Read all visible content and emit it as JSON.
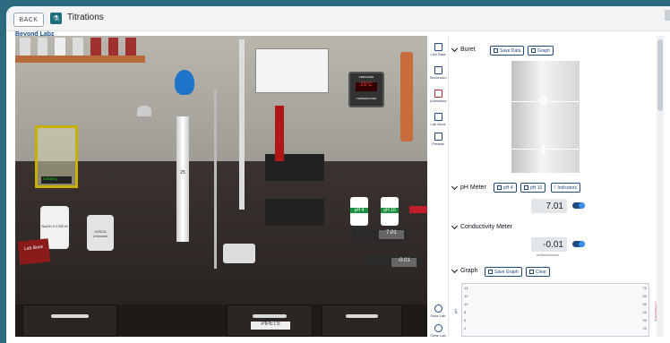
{
  "app": {
    "back_label": "BACK",
    "title": "Titrations",
    "brand": "Beyond Labz"
  },
  "side_nav": [
    {
      "label": "Live Data",
      "icon": "table-icon"
    },
    {
      "label": "Stockroom",
      "icon": "stockroom-icon"
    },
    {
      "label": "Unknowns",
      "icon": "flask-icon"
    },
    {
      "label": "Lab Book",
      "icon": "book-icon"
    },
    {
      "label": "Presets",
      "icon": "presets-icon"
    }
  ],
  "side_bottom": [
    {
      "label": "Save Lab",
      "icon": "upload-icon"
    },
    {
      "label": "Clear Lab",
      "icon": "refresh-icon"
    }
  ],
  "buret": {
    "header": "Buret",
    "save_data": "Save Data",
    "graph": "Graph",
    "marks": [
      "0",
      "1"
    ]
  },
  "ph_meter": {
    "header": "pH Meter",
    "ph4": "pH 4",
    "ph10": "pH 10",
    "indicators": "Indicators",
    "value": "7.01"
  },
  "conductivity": {
    "header": "Conductivity Meter",
    "value": "-0.01",
    "unit": "mSiemens/cm"
  },
  "graph": {
    "header": "Graph",
    "save_graph": "Save Graph",
    "clear": "Clear",
    "left_ticks": [
      "14",
      "12",
      "10",
      "8",
      "6",
      "4"
    ],
    "right_ticks": [
      "70",
      "60",
      "50",
      "40",
      "30",
      "20"
    ],
    "left_axis": "pH",
    "right_axis": "Conductivity"
  },
  "lab_scene": {
    "pressure_title": "PRESSURE",
    "temperature_readout": "25°C",
    "temperature_label": "TEMPERATURE",
    "balance_readout": "0.0000 g",
    "buret_mark": "25",
    "bottle_naoh": "NaOH 0.2785 M",
    "bottle_h2so4": "H2SO4 Unknown",
    "lab_book": "Lab Book",
    "ph4_bottle": "pH 4",
    "ph10_bottle": "pH 10",
    "ph_meter_reading": "7.01",
    "cond_meter_reading": "-0.01",
    "drawer_label": "PIPETS"
  },
  "colors": {
    "accent": "#1f4a80",
    "header_bg": "#2b6a80",
    "toggle": "#3a8ef0"
  }
}
